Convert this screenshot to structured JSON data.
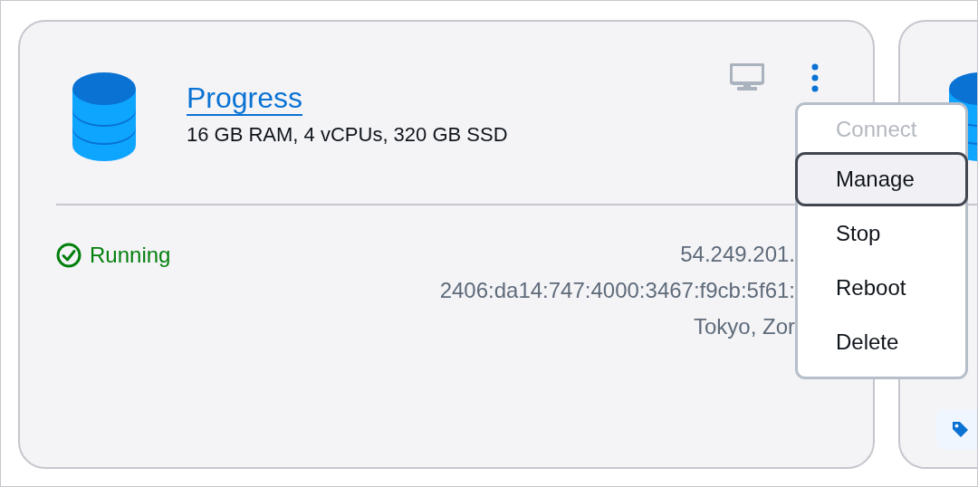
{
  "cards": [
    {
      "kind": "database",
      "title": "Progress",
      "specs": "16 GB RAM, 4 vCPUs, 320 GB SSD",
      "status": {
        "kind": "running",
        "label": "Running"
      },
      "details": [
        "54.249.201.",
        "2406:da14:747:4000:3467:f9cb:5f61:",
        "Tokyo, Zor"
      ]
    },
    {
      "kind": "database"
    }
  ],
  "menu": {
    "items": [
      {
        "label": "Connect",
        "disabled": true,
        "selected": false
      },
      {
        "label": "Manage",
        "disabled": false,
        "selected": true
      },
      {
        "label": "Stop",
        "disabled": false,
        "selected": false
      },
      {
        "label": "Reboot",
        "disabled": false,
        "selected": false
      },
      {
        "label": "Delete",
        "disabled": false,
        "selected": false
      }
    ]
  }
}
